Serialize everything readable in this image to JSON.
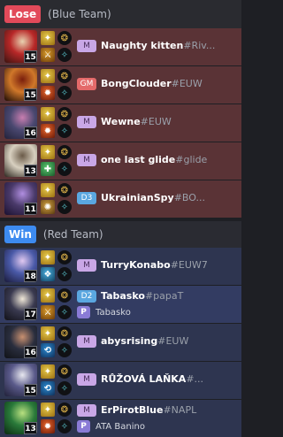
{
  "colors": {
    "lose_badge": "#e24a5a",
    "win_badge": "#3d8bf0",
    "lose_row": "#5a3336",
    "win_row": "#2e3550",
    "highlight_border": "#e6b13a",
    "party_badge": "#8a7bd6"
  },
  "teams": [
    {
      "result": "Lose",
      "team_name": "(Blue Team)",
      "players": [
        {
          "champion_icon": "champion-portrait-icon",
          "level": "15",
          "rank": "M",
          "rank_color": "#c9a7e6",
          "rank_text_color": "#4a2f5c",
          "name": "Naughty kitten",
          "tag": "#Riv...",
          "spells": [
            "flash-spell-icon",
            "smite-spell-icon"
          ],
          "runes": [
            "rune-primary-icon",
            "rune-secondary-icon"
          ]
        },
        {
          "champion_icon": "champion-portrait-icon",
          "level": "15",
          "rank": "GM",
          "rank_color": "#e46a6a",
          "rank_text_color": "#ffffff",
          "name": "BongClouder",
          "tag": "#EUW",
          "spells": [
            "flash-spell-icon",
            "ignite-spell-icon"
          ],
          "runes": [
            "rune-primary-icon",
            "rune-secondary-icon"
          ]
        },
        {
          "champion_icon": "champion-portrait-icon",
          "level": "16",
          "rank": "M",
          "rank_color": "#c9a7e6",
          "rank_text_color": "#4a2f5c",
          "name": "Wewne",
          "tag": "#EUW",
          "spells": [
            "flash-spell-icon",
            "ignite-spell-icon"
          ],
          "runes": [
            "rune-primary-icon",
            "rune-secondary-icon"
          ]
        },
        {
          "champion_icon": "champion-portrait-icon",
          "level": "13",
          "rank": "M",
          "rank_color": "#c9a7e6",
          "rank_text_color": "#4a2f5c",
          "name": "one last glide",
          "tag": "#glide",
          "spells": [
            "flash-spell-icon",
            "heal-spell-icon"
          ],
          "runes": [
            "rune-primary-icon",
            "rune-secondary-icon"
          ]
        },
        {
          "champion_icon": "champion-portrait-icon",
          "level": "11",
          "rank": "D3",
          "rank_color": "#5aa7e0",
          "rank_text_color": "#ffffff",
          "name": "UkrainianSpy",
          "tag": "#BO...",
          "spells": [
            "flash-spell-icon",
            "exhaust-spell-icon"
          ],
          "runes": [
            "rune-primary-icon",
            "rune-secondary-icon"
          ]
        }
      ]
    },
    {
      "result": "Win",
      "team_name": "(Red Team)",
      "players": [
        {
          "champion_icon": "champion-portrait-icon",
          "level": "18",
          "rank": "M",
          "rank_color": "#c9a7e6",
          "rank_text_color": "#4a2f5c",
          "name": "TurryKonabo",
          "tag": "#EUW7",
          "spells": [
            "flash-spell-icon",
            "ghost-spell-icon"
          ],
          "runes": [
            "rune-primary-icon",
            "rune-secondary-icon"
          ]
        },
        {
          "champion_icon": "champion-portrait-icon",
          "level": "17",
          "rank": "D2",
          "rank_color": "#5aa7e0",
          "rank_text_color": "#ffffff",
          "name": "Tabasko",
          "tag": "#papaT",
          "party_badge": "P",
          "party_text": "Tabasko",
          "spells": [
            "flash-spell-icon",
            "smite-spell-icon"
          ],
          "runes": [
            "rune-primary-icon",
            "rune-secondary-icon"
          ]
        },
        {
          "champion_icon": "champion-portrait-icon",
          "level": "16",
          "rank": "M",
          "rank_color": "#c9a7e6",
          "rank_text_color": "#4a2f5c",
          "name": "abysrising",
          "tag": "#EUW",
          "spells": [
            "flash-spell-icon",
            "teleport-spell-icon"
          ],
          "runes": [
            "rune-primary-icon",
            "rune-secondary-icon"
          ]
        },
        {
          "champion_icon": "champion-portrait-icon",
          "level": "15",
          "rank": "M",
          "rank_color": "#c9a7e6",
          "rank_text_color": "#4a2f5c",
          "name": "RŮŽOVÁ LAŇKA",
          "tag": "#...",
          "spells": [
            "flash-spell-icon",
            "teleport-spell-icon"
          ],
          "runes": [
            "rune-primary-icon",
            "rune-secondary-icon"
          ]
        },
        {
          "champion_icon": "champion-portrait-icon",
          "level": "13",
          "rank": "M",
          "rank_color": "#c9a7e6",
          "rank_text_color": "#4a2f5c",
          "name": "ErPirotBlue",
          "tag": "#NAPL",
          "party_badge": "P",
          "party_text": "ATA Banino",
          "spells": [
            "flash-spell-icon",
            "ignite-spell-icon"
          ],
          "runes": [
            "rune-primary-icon",
            "rune-secondary-icon"
          ]
        }
      ]
    }
  ]
}
